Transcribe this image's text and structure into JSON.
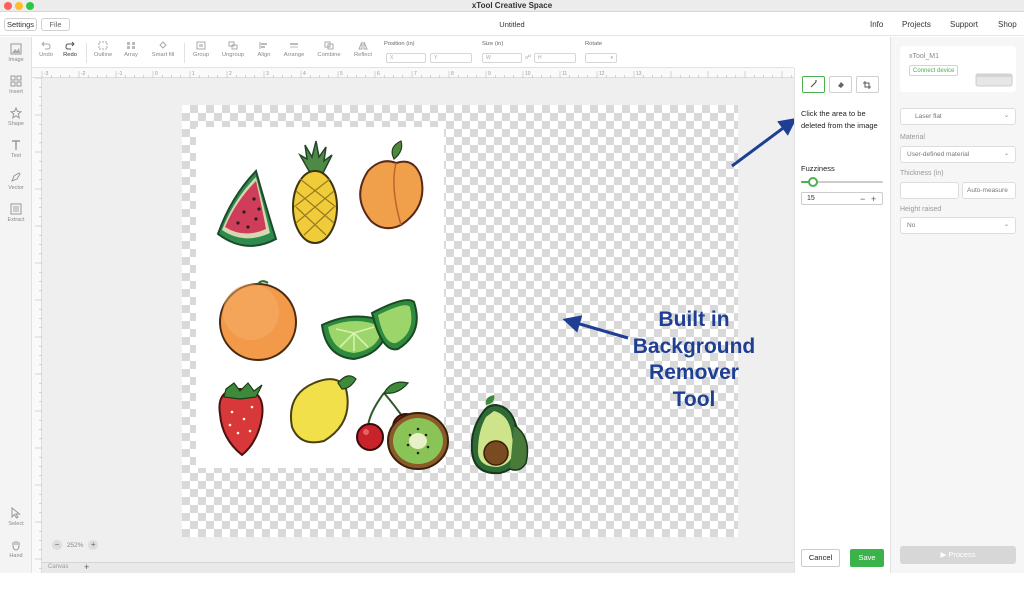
{
  "window": {
    "app_title": "xTool Creative Space"
  },
  "menubar": {
    "settings_label": "Settings",
    "file_label": "File",
    "doc_title": "Untitled",
    "nav": [
      "Info",
      "Projects",
      "Support",
      "Shop"
    ]
  },
  "left_tools": [
    "Image",
    "Insert",
    "Shape",
    "Text",
    "Vector",
    "Extract"
  ],
  "bottom_tools": [
    "Select",
    "Hand"
  ],
  "toolbar": {
    "undo": "Undo",
    "redo": "Redo",
    "outline": "Outline",
    "array": "Array",
    "smart_fill": "Smart fill",
    "group": "Group",
    "ungroup": "Ungroup",
    "align": "Align",
    "arrange": "Arrange",
    "combine": "Combine",
    "reflect": "Reflect",
    "position_label": "Position (in)",
    "size_label": "Size (in)",
    "rotate_label": "Rotate",
    "x_placeholder": "X",
    "y_placeholder": "Y",
    "w_placeholder": "W",
    "h_placeholder": "H"
  },
  "ruler": {
    "h_ticks": [
      "-3",
      "-2",
      "-1",
      "0",
      "1",
      "2",
      "3",
      "4",
      "5",
      "6",
      "7",
      "8",
      "9",
      "10",
      "11",
      "12",
      "13"
    ]
  },
  "canvas": {
    "zoom": "252%",
    "tab_label": "Canvas"
  },
  "annotation": {
    "lines": [
      "Built in",
      "Background",
      "Remover",
      "Tool"
    ]
  },
  "bg_panel": {
    "instruction": "Click the area to be deleted from the image",
    "fuzziness_label": "Fuzziness",
    "fuzziness_value": "15",
    "fuzziness_fraction": 0.15,
    "cancel_label": "Cancel",
    "save_label": "Save"
  },
  "device_panel": {
    "device_name": "xTool_M1",
    "status": "Connect device",
    "mode": "Laser flat",
    "material_label": "Material",
    "material_value": "User-defined material",
    "thickness_label": "Thickness (in)",
    "auto_measure": "Auto-measure",
    "height_label": "Height raised",
    "height_value": "No",
    "process_label": "Process"
  },
  "colors": {
    "accent": "#3cb34a",
    "annotation": "#1f3f95"
  }
}
